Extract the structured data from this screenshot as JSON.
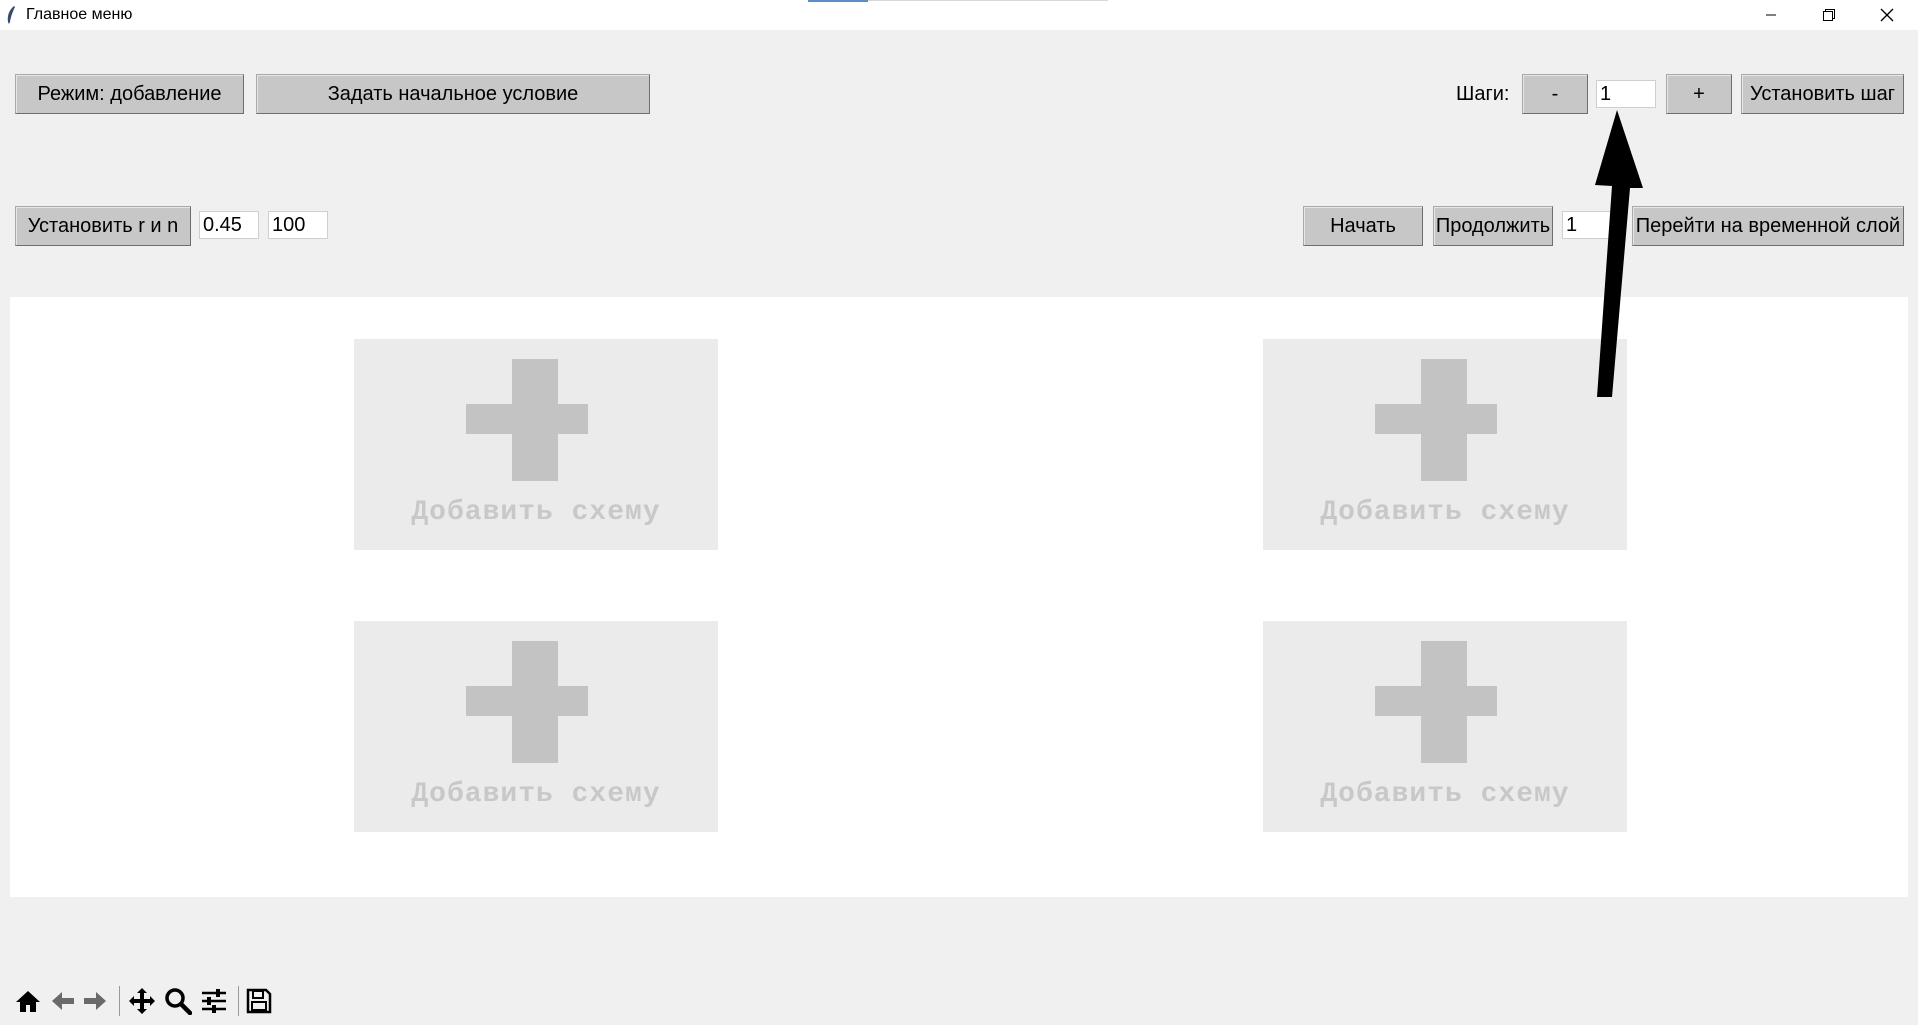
{
  "window": {
    "title": "Главное меню",
    "controls": [
      "minimize-icon",
      "restore-icon",
      "close-icon"
    ]
  },
  "top_row": {
    "mode_button": "Режим: добавление",
    "initial_condition_button": "Задать начальное условие",
    "steps_label": "Шаги:",
    "minus_button": "-",
    "steps_value": "1",
    "plus_button": "+",
    "set_step_button": "Установить шаг"
  },
  "second_row": {
    "set_r_n_button": "Установить r и n",
    "r_value": "0.45",
    "n_value": "100",
    "start_button": "Начать",
    "continue_button": "Продолжить",
    "layer_value": "1",
    "goto_layer_button": "Перейти на временной слой"
  },
  "canvas": {
    "cards": [
      {
        "label": "Добавить схему"
      },
      {
        "label": "Добавить схему"
      },
      {
        "label": "Добавить схему"
      },
      {
        "label": "Добавить схему"
      }
    ]
  },
  "toolbar": {
    "icons": [
      "home-icon",
      "back-arrow-icon",
      "forward-arrow-icon",
      "pan-icon",
      "zoom-icon",
      "configure-subplots-icon",
      "save-icon"
    ]
  },
  "colors": {
    "window_bg": "#f0f0f0",
    "button_bg": "#c7c7c7",
    "card_bg": "#ebebeb",
    "plus_color": "#c3c3c3",
    "card_text": "#c8c8c8",
    "arrow": "#000000"
  }
}
